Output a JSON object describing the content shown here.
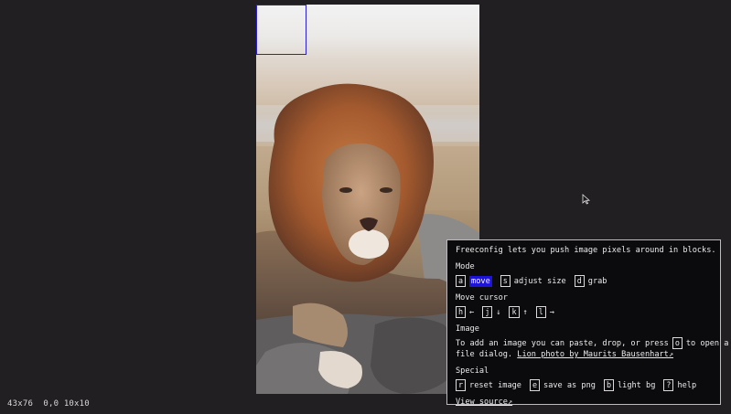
{
  "status": {
    "size": "43x76",
    "cursor": "0,0 10x10"
  },
  "photo": {
    "subject": "lion",
    "colors": {
      "mane": "#a45a2e",
      "face": "#b99272",
      "rock": "#5e5c5c"
    }
  },
  "selection": {
    "color": "#2a1fd6"
  },
  "help": {
    "intro": "Freeconfig lets you push image pixels around in blocks.",
    "mode": {
      "heading": "Mode",
      "items": [
        {
          "key": "a",
          "label": "move",
          "active": true
        },
        {
          "key": "s",
          "label": "adjust size",
          "active": false
        },
        {
          "key": "d",
          "label": "grab",
          "active": false
        }
      ]
    },
    "move_cursor": {
      "heading": "Move cursor",
      "items": [
        {
          "key": "h",
          "label": "←"
        },
        {
          "key": "j",
          "label": "↓"
        },
        {
          "key": "k",
          "label": "↑"
        },
        {
          "key": "l",
          "label": "→"
        }
      ]
    },
    "image": {
      "heading": "Image",
      "text_before": "To add an image you can paste, drop, or press",
      "key": "o",
      "text_after": "to open a",
      "text_line2": "file dialog.",
      "credit_link": "Lion photo by Maurits Bausenhart↗"
    },
    "special": {
      "heading": "Special",
      "items": [
        {
          "key": "r",
          "label": "reset image"
        },
        {
          "key": "e",
          "label": "save as png"
        },
        {
          "key": "b",
          "label": "light bg"
        },
        {
          "key": "?",
          "label": "help"
        }
      ]
    },
    "source_link": "View source↗"
  }
}
